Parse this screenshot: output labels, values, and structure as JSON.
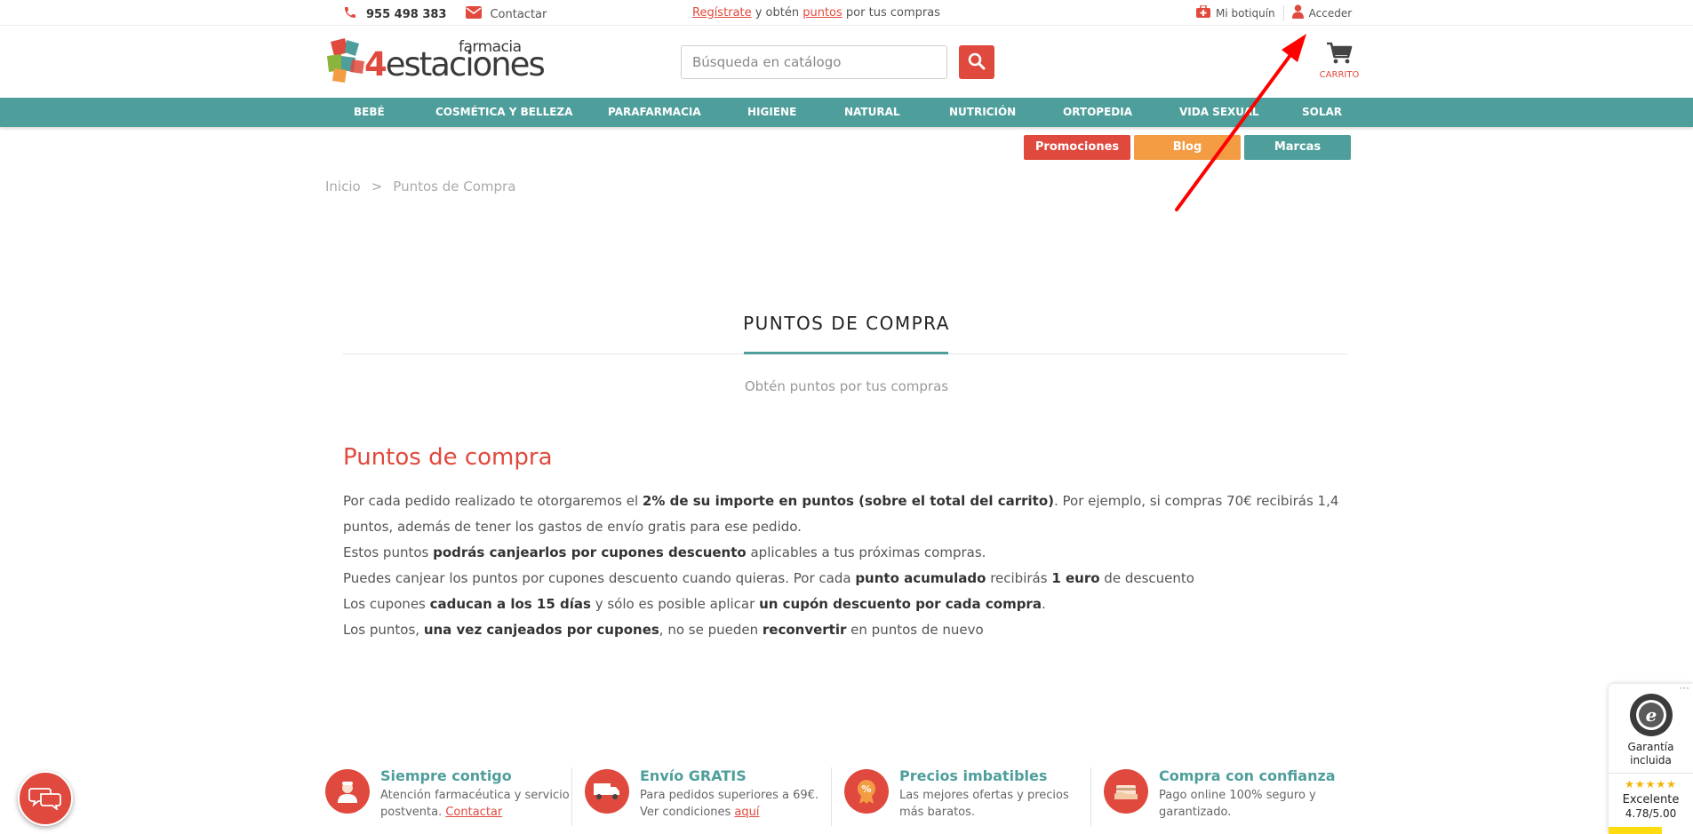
{
  "topbar": {
    "phone": "955 498 383",
    "contact": "Contactar",
    "promo": {
      "register": "Regístrate",
      "mid": " y obtén ",
      "points": "puntos",
      "end": " por tus compras"
    },
    "my_kit": "Mi botiquín",
    "login": "Acceder"
  },
  "header": {
    "logo_number": "4",
    "logo_word": "estaciones",
    "logo_small": "farmacia",
    "search_placeholder": "Búsqueda en catálogo",
    "cart_label": "CARRITO"
  },
  "nav": [
    "BEBÉ",
    "COSMÉTICA Y BELLEZA",
    "PARAFARMACIA",
    "HIGIENE",
    "NATURAL",
    "NUTRICIÓN",
    "ORTOPEDIA",
    "VIDA SEXUAL",
    "SOLAR"
  ],
  "subnav": {
    "promociones": "Promociones",
    "blog": "Blog",
    "marcas": "Marcas"
  },
  "breadcrumb": {
    "home": "Inicio",
    "sep": ">",
    "current": "Puntos de Compra"
  },
  "page": {
    "title": "PUNTOS DE COMPRA",
    "subtitle": "Obtén puntos por tus compras"
  },
  "content": {
    "heading": "Puntos de compra",
    "p1": {
      "a": "Por cada pedido realizado te otorgaremos el ",
      "b": "2% de su importe en puntos (sobre el total del carrito)",
      "c": ". Por ejemplo, si compras 70€ recibirás 1,4 puntos, además de tener los gastos de envío gratis para ese pedido."
    },
    "p2": {
      "a": "Estos puntos ",
      "b": "podrás canjearlos por cupones descuento",
      "c": " aplicables a tus próximas compras."
    },
    "p3": {
      "a": "Puedes canjear los puntos por cupones descuento cuando quieras. Por cada ",
      "b": "punto acumulado",
      "c": " recibirás ",
      "d": "1 euro",
      "e": " de descuento"
    },
    "p4": {
      "a": "Los cupones ",
      "b": "caducan a los 15 días",
      "c": " y sólo es posible aplicar ",
      "d": "un cupón descuento por cada compra",
      "e": "."
    },
    "p5": {
      "a": "Los puntos, ",
      "b": "una vez canjeados por cupones",
      "c": ", no se pueden ",
      "d": "reconvertir",
      "e": " en puntos de nuevo"
    }
  },
  "features": [
    {
      "title": "Siempre contigo",
      "line1": "Atención farmacéutica y servicio",
      "line2": "postventa. ",
      "link": "Contactar"
    },
    {
      "title": "Envío GRATIS",
      "line1": "Para pedidos superiores a 69€.",
      "line2": "Ver condiciones ",
      "link": "aquí"
    },
    {
      "title": "Precios imbatibles",
      "line1": "Las mejores ofertas y precios",
      "line2": "más baratos.",
      "link": ""
    },
    {
      "title": "Compra con confianza",
      "line1": "Pago online 100% seguro y",
      "line2": "garantizado.",
      "link": ""
    }
  ],
  "trust": {
    "dots": "···",
    "guarantee1": "Garantía",
    "guarantee2": "incluida",
    "stars": "★★★★★",
    "rating_word": "Excelente",
    "score": "4.78/5.00"
  },
  "icons": {
    "phone": "phone-icon",
    "mail": "mail-icon",
    "kit": "first-aid-kit-icon",
    "user": "user-icon",
    "search": "search-icon",
    "cart": "cart-icon",
    "chat": "chat-icon"
  },
  "colors": {
    "accent": "#e0493d",
    "teal": "#4e9e9b",
    "orange": "#f39c44"
  }
}
